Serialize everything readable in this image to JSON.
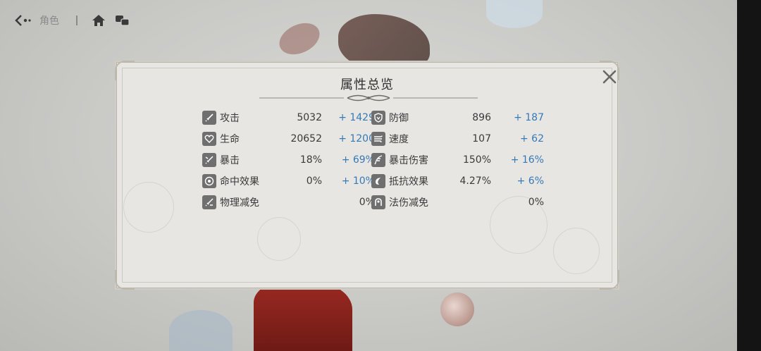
{
  "topnav": {
    "title": "角色"
  },
  "panel": {
    "title": "属性总览"
  },
  "stats": [
    {
      "icon": "sword-icon",
      "name": "攻击",
      "value": "5032",
      "bonus": "+ 1429"
    },
    {
      "icon": "shield-icon",
      "name": "防御",
      "value": "896",
      "bonus": "+ 187"
    },
    {
      "icon": "heart-icon",
      "name": "生命",
      "value": "20652",
      "bonus": "+ 1200"
    },
    {
      "icon": "wind-icon",
      "name": "速度",
      "value": "107",
      "bonus": "+ 62"
    },
    {
      "icon": "crit-sword-icon",
      "name": "暴击",
      "value": "18%",
      "bonus": "+ 69%"
    },
    {
      "icon": "feather-blade-icon",
      "name": "暴击伤害",
      "value": "150%",
      "bonus": "+ 16%"
    },
    {
      "icon": "target-icon",
      "name": "命中效果",
      "value": "0%",
      "bonus": "+ 10%"
    },
    {
      "icon": "resist-icon",
      "name": "抵抗效果",
      "value": "4.27%",
      "bonus": "+ 6%"
    },
    {
      "icon": "physical-reduce-icon",
      "name": "物理减免",
      "value": "",
      "bonus": "0%"
    },
    {
      "icon": "magic-reduce-icon",
      "name": "法伤减免",
      "value": "",
      "bonus": "0%"
    }
  ]
}
